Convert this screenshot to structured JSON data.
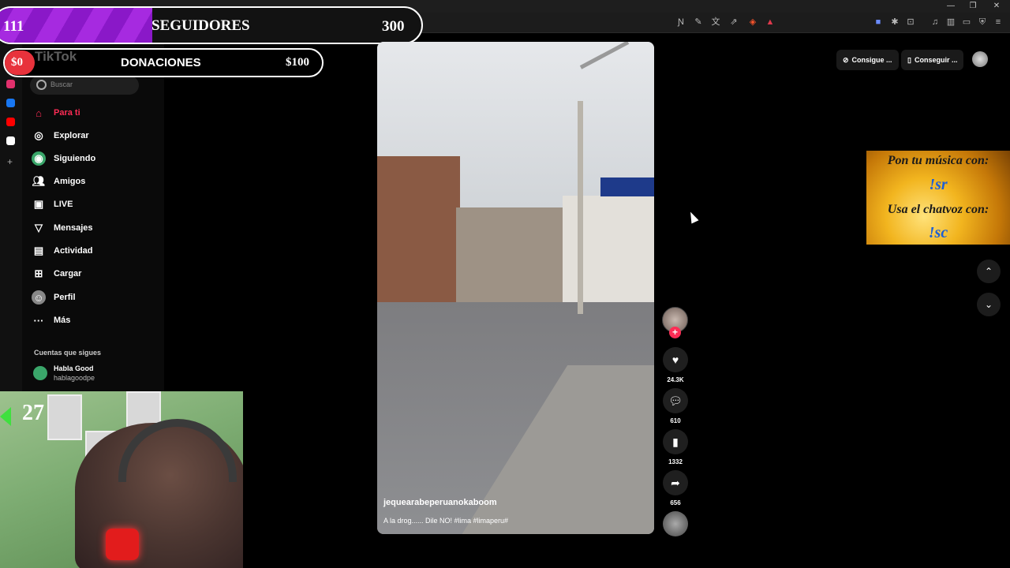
{
  "overlay": {
    "followers": {
      "current": "111",
      "label": "SEGUIDORES",
      "goal": "300",
      "progress_fraction": 0.37
    },
    "donations": {
      "current": "$0",
      "label": "DONACIONES",
      "goal": "$100"
    },
    "logo": "TikTok"
  },
  "sidebar": {
    "search_placeholder": "Buscar",
    "items": [
      {
        "label": "Para ti",
        "icon": "home-icon",
        "active": true
      },
      {
        "label": "Explorar",
        "icon": "compass-icon"
      },
      {
        "label": "Siguiendo",
        "icon": "following-icon"
      },
      {
        "label": "Amigos",
        "icon": "friends-icon"
      },
      {
        "label": "LIVE",
        "icon": "live-icon"
      },
      {
        "label": "Mensajes",
        "icon": "send-icon"
      },
      {
        "label": "Actividad",
        "icon": "activity-icon"
      },
      {
        "label": "Cargar",
        "icon": "upload-icon"
      },
      {
        "label": "Perfil",
        "icon": "profile-icon"
      },
      {
        "label": "Más",
        "icon": "more-icon"
      }
    ],
    "following_heading": "Cuentas que sigues",
    "following": [
      {
        "name": "Habla Good",
        "handle": "hablagoodpe"
      }
    ]
  },
  "webcam": {
    "count": "27"
  },
  "video": {
    "username": "jequearabeperuanokaboom",
    "description": "A la drog...... Dile NO! #lima #limaperu#"
  },
  "actions": {
    "likes": "24.3K",
    "comments": "610",
    "saves": "1332",
    "shares": "656"
  },
  "top_right": {
    "button1": "Consigue ...",
    "button2": "Conseguir ..."
  },
  "honey_overlay": {
    "line1": "Pon tu música con:",
    "line2": "!sr",
    "line3": "Usa el chatvoz con:",
    "line4": "!sc"
  }
}
